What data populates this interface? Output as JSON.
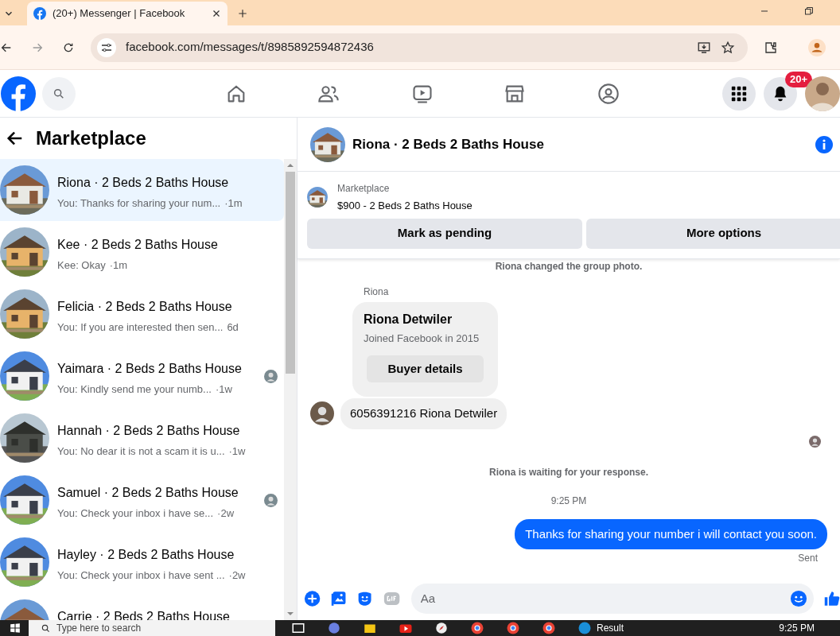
{
  "browser": {
    "tab_title": "(20+) Messenger | Facebook",
    "url": "facebook.com/messages/t/8985892594872436"
  },
  "nav": {
    "notification_badge": "20+"
  },
  "sidebar": {
    "title": "Marketplace",
    "conversations": [
      {
        "name": "Riona · 2 Beds 2 Baths House",
        "preview": "You: Thanks for sharing your num...",
        "time": "·1m",
        "selected": true,
        "seen_avatar": false
      },
      {
        "name": "Kee · 2 Beds 2 Baths House",
        "preview": "Kee: Okay",
        "time": "·1m",
        "selected": false,
        "seen_avatar": false
      },
      {
        "name": "Felicia · 2 Beds 2 Baths House",
        "preview": "You: If you are interested then sen...",
        "time": "6d",
        "selected": false,
        "seen_avatar": false
      },
      {
        "name": "Yaimara · 2 Beds 2 Baths House",
        "preview": "You: Kindly send me your numb...",
        "time": "·1w",
        "selected": false,
        "seen_avatar": true
      },
      {
        "name": "Hannah · 2 Beds 2 Baths House",
        "preview": "You: No dear it is not a scam it is u...",
        "time": "·1w",
        "selected": false,
        "seen_avatar": false
      },
      {
        "name": "Samuel · 2 Beds 2 Baths House",
        "preview": "You: Check your inbox i have se...",
        "time": "·2w",
        "selected": false,
        "seen_avatar": true
      },
      {
        "name": "Hayley · 2 Beds 2 Baths House",
        "preview": "You: Check your inbox i have sent ...",
        "time": "·2w",
        "selected": false,
        "seen_avatar": false
      },
      {
        "name": "Carrie · 2 Beds 2 Baths House",
        "selected": false,
        "seen_avatar": false
      }
    ]
  },
  "chat": {
    "title": "Riona · 2 Beds 2 Baths House",
    "listing": {
      "label": "Marketplace",
      "item": "$900 - 2 Beds 2 Baths House",
      "buttons": [
        "Mark as pending",
        "More options"
      ]
    },
    "messages": [
      {
        "kind": "notice",
        "text": "Riona changed the group photo."
      },
      {
        "kind": "card",
        "sender": "Riona",
        "title": "Riona Detwiler",
        "subtitle": "Joined Facebook in 2015",
        "button": "Buyer details"
      },
      {
        "kind": "incoming",
        "text": "6056391216 Riona Detwiler"
      },
      {
        "kind": "read_receipt"
      },
      {
        "kind": "notice",
        "text": "Riona is waiting for your response."
      },
      {
        "kind": "time",
        "text": "9:25 PM"
      },
      {
        "kind": "outgoing",
        "text": "Thanks for sharing your number i will contact you soon.",
        "status": "Sent"
      }
    ],
    "composer": {
      "placeholder": "Aa"
    }
  },
  "taskbar": {
    "search_placeholder": "Type here to search",
    "app_label": "Result",
    "clock": "9:25 PM"
  }
}
